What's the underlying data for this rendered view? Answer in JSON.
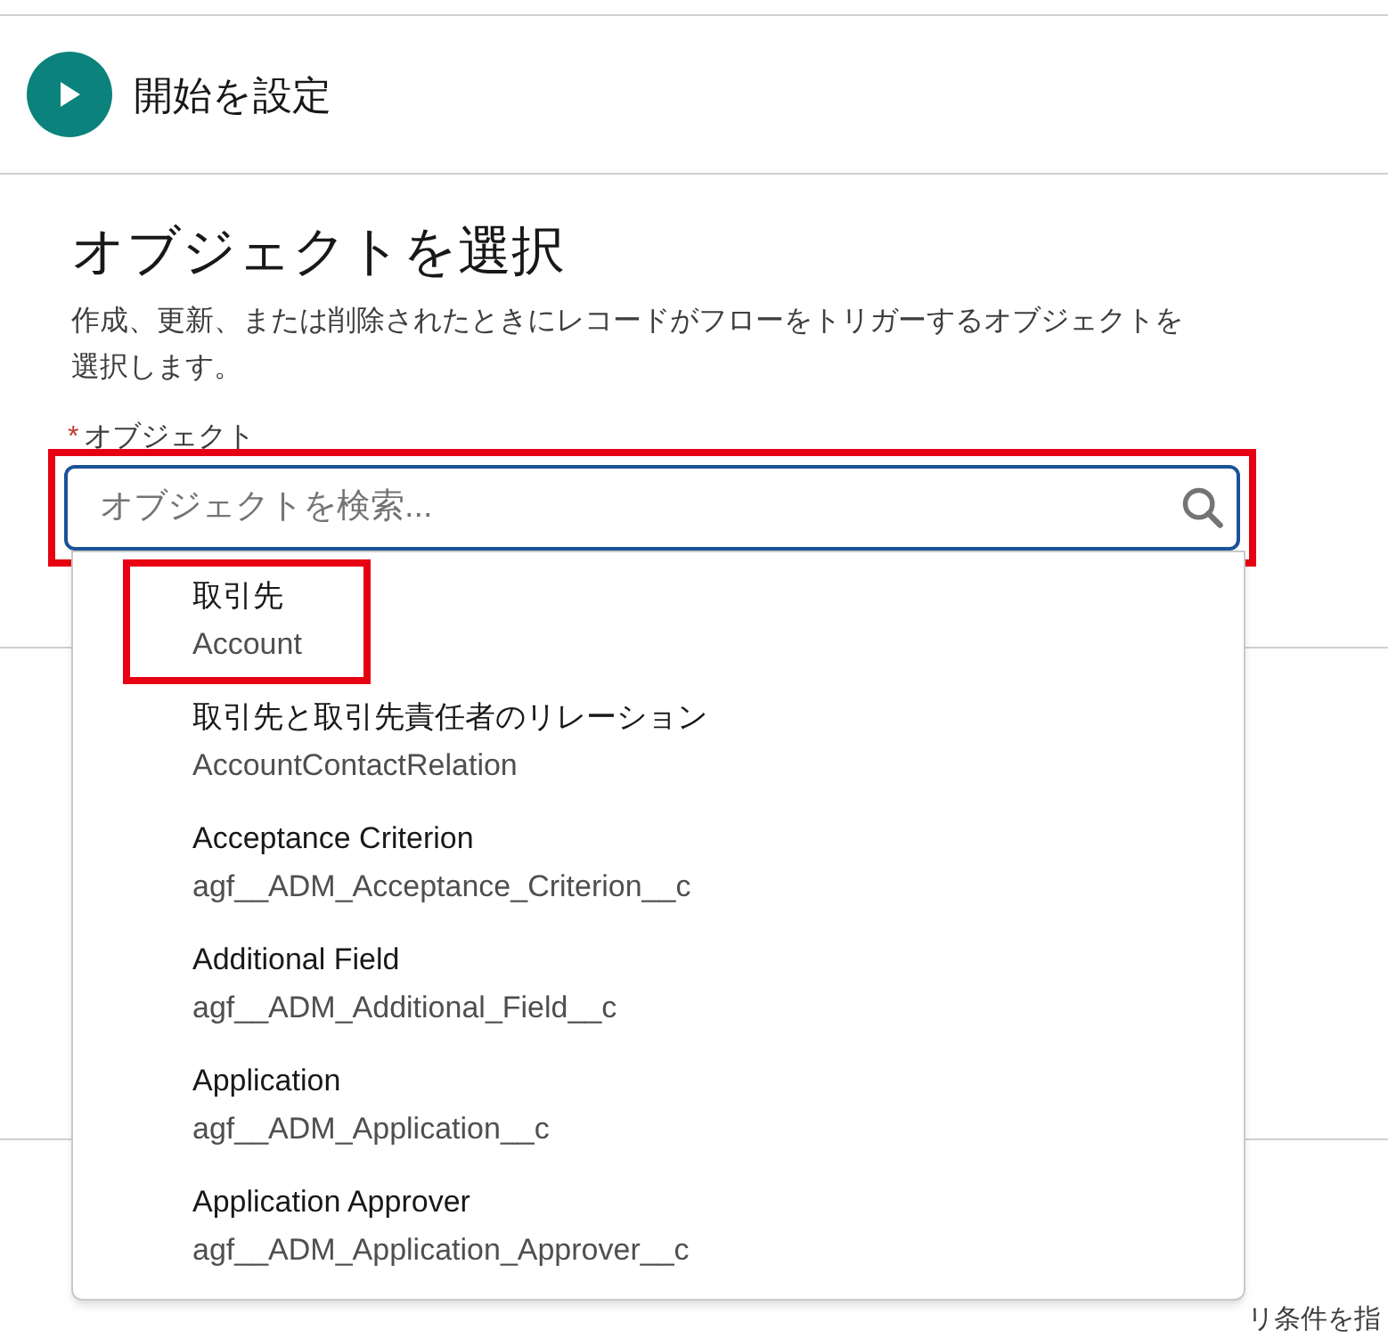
{
  "header": {
    "title": "開始を設定"
  },
  "section": {
    "title": "オブジェクトを選択",
    "description": "作成、更新、または削除されたときにレコードがフローをトリガーするオブジェクトを選択します。",
    "field": {
      "label": "オブジェクト",
      "required_mark": "*",
      "placeholder": "オブジェクトを検索...",
      "highlighted": true
    }
  },
  "options": [
    {
      "label": "取引先",
      "api_name": "Account",
      "highlighted": true
    },
    {
      "label": "取引先と取引先責任者のリレーション",
      "api_name": "AccountContactRelation",
      "highlighted": false
    },
    {
      "label": "Acceptance Criterion",
      "api_name": "agf__ADM_Acceptance_Criterion__c",
      "highlighted": false
    },
    {
      "label": "Additional Field",
      "api_name": "agf__ADM_Additional_Field__c",
      "highlighted": false
    },
    {
      "label": "Application",
      "api_name": "agf__ADM_Application__c",
      "highlighted": false
    },
    {
      "label": "Application Approver",
      "api_name": "agf__ADM_Application_Approver__c",
      "highlighted": false
    }
  ],
  "footer_text": "リ条件を指"
}
